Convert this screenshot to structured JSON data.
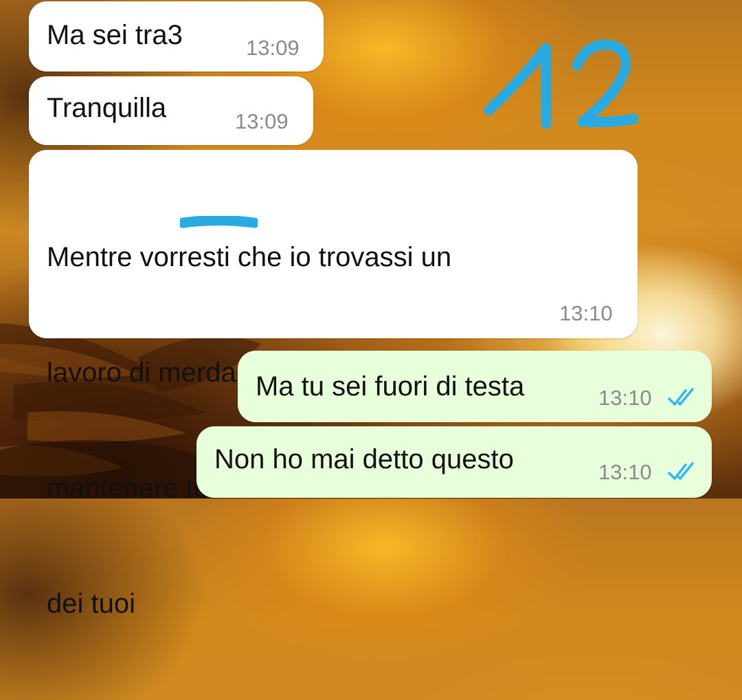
{
  "messages": [
    {
      "direction": "incoming",
      "text": "Ma sei tra3",
      "time": "13:09"
    },
    {
      "direction": "incoming",
      "text": "Tranquilla",
      "time": "13:09"
    },
    {
      "direction": "incoming",
      "lines": [
        "Mentre vorresti che io trovassi un",
        "lavoro di merda ma ben pagato per",
        "mantenere te e farti uscire dalla casa",
        "dei tuoi"
      ],
      "time": "13:10"
    },
    {
      "direction": "outgoing",
      "text": "Ma tu sei fuori di testa",
      "time": "13:10",
      "status": "read"
    },
    {
      "direction": "outgoing",
      "text": "Non ho mai detto questo",
      "time": "13:10",
      "status": "read"
    }
  ],
  "annotation": {
    "label": "12",
    "color": "#29abe2"
  },
  "colors": {
    "incoming_bubble": "#ffffff",
    "outgoing_bubble": "#e7ffdb",
    "read_ticks": "#34b7f1",
    "timestamp": "#8a8a8a",
    "censor_mark": "#29abe2"
  },
  "icons": {
    "read_receipt": "double-check-icon"
  }
}
